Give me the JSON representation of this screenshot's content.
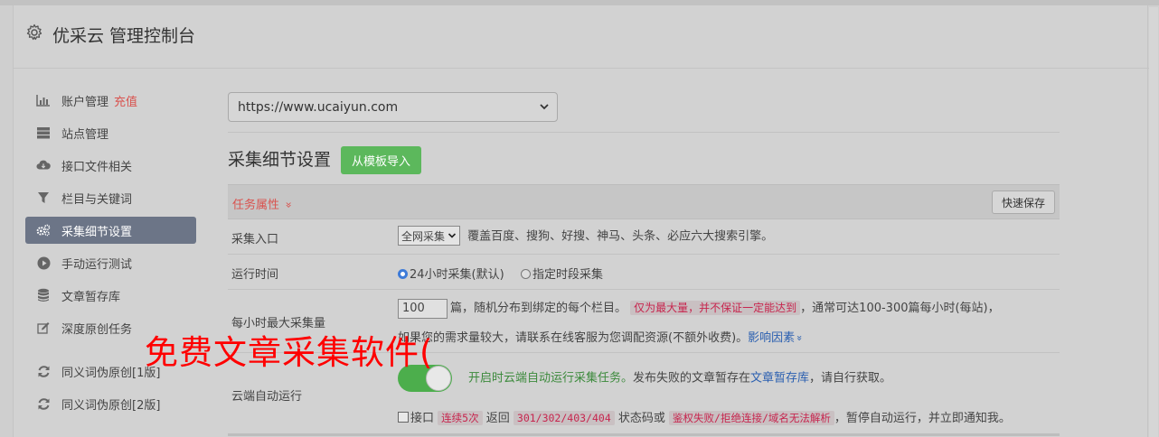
{
  "header": {
    "title": "优采云 管理控制台",
    "icon": "gear-icon"
  },
  "sidebar": {
    "items": [
      {
        "label": "账户管理",
        "tag": "充值",
        "icon": "bar-chart-icon",
        "active": false
      },
      {
        "label": "站点管理",
        "icon": "server-icon",
        "active": false
      },
      {
        "label": "接口文件相关",
        "icon": "cloud-download-icon",
        "active": false
      },
      {
        "label": "栏目与关键词",
        "icon": "filter-icon",
        "active": false
      },
      {
        "label": "采集细节设置",
        "icon": "cogs-icon",
        "active": true
      },
      {
        "label": "手动运行测试",
        "icon": "play-circle-icon",
        "active": false
      },
      {
        "label": "文章暂存库",
        "icon": "database-icon",
        "active": false
      },
      {
        "label": "深度原创任务",
        "icon": "edit-icon",
        "active": false
      },
      {
        "label": "同义词伪原创[1版]",
        "icon": "refresh-icon",
        "active": false
      },
      {
        "label": "同义词伪原创[2版]",
        "icon": "refresh-icon",
        "active": false
      }
    ]
  },
  "main": {
    "site_select": {
      "value": "https://www.ucaiyun.com"
    },
    "section_title": "采集细节设置",
    "import_button": "从模板导入",
    "task_bar": {
      "label": "任务属性",
      "chevron": "»",
      "save_button": "快速保存"
    },
    "rows": {
      "entry": {
        "label": "采集入口",
        "select_value": "全网采集",
        "desc": "覆盖百度、搜狗、好搜、神马、头条、必应六大搜索引擎。"
      },
      "runtime": {
        "label": "运行时间",
        "option1": "24小时采集(默认)",
        "option2": "指定时段采集"
      },
      "max": {
        "label": "每小时最大采集量",
        "input_value": "100",
        "text1": "篇，随机分布到绑定的每个栏目。",
        "warn": "仅为最大量，并不保证一定能达到",
        "text2": "，通常可达100-300篇每小时(每站)，",
        "text3": "如果您的需求量较大，请联系在线客服为您调配资源(不额外收费)。",
        "link": "影响因素",
        "link_chevron": "»"
      },
      "cloud": {
        "label": "云端自动运行",
        "toggle_on": true,
        "green_text": "开启时云端自动运行采集任务。",
        "text1": "发布失败的文章暂存在",
        "link": "文章暂存库",
        "text2": "，请自行获取。",
        "chk_label": "接口",
        "code1": "连续5次",
        "text3": "返回",
        "code2": "301/302/403/404",
        "text4": "状态码或",
        "code3": "鉴权失败/拒绝连接/域名无法解析",
        "text5": "，暂停自动运行，并立即通知我。"
      }
    }
  },
  "watermark": "免费文章采集软件(",
  "colors": {
    "active_nav": "#6c7587",
    "green": "#5cb85c",
    "red": "#d9534f",
    "link": "#2a5fb0"
  }
}
